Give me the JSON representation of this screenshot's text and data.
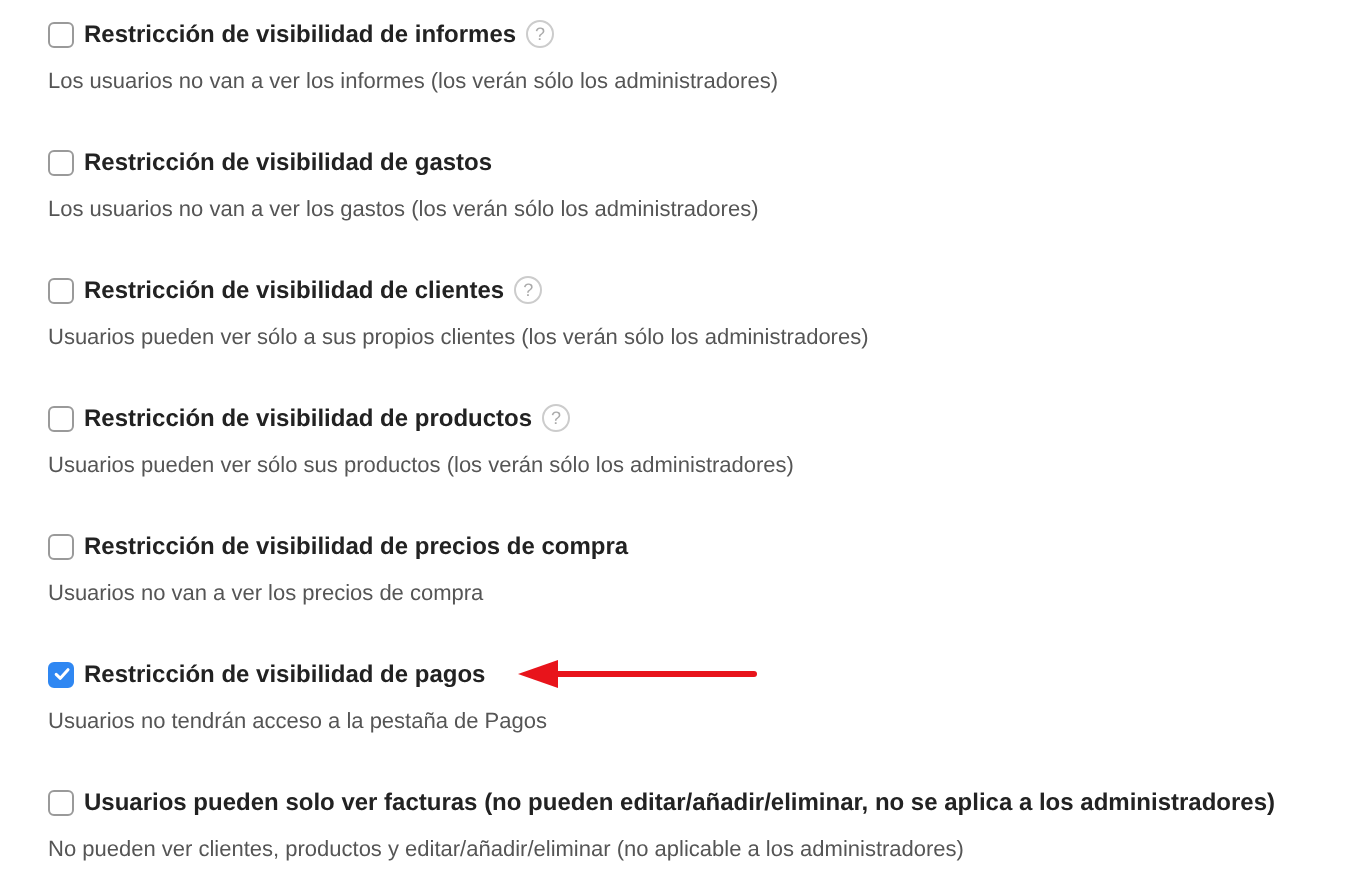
{
  "options": [
    {
      "label": "Restricción de visibilidad de informes",
      "checked": false,
      "help": "?",
      "description": "Los usuarios no van a ver los informes (los verán sólo los administradores)"
    },
    {
      "label": "Restricción de visibilidad de gastos",
      "checked": false,
      "description": "Los usuarios no van a ver los gastos (los verán sólo los administradores)"
    },
    {
      "label": "Restricción de visibilidad de clientes",
      "checked": false,
      "help": "?",
      "description": "Usuarios pueden ver sólo a sus propios clientes (los verán sólo los administradores)"
    },
    {
      "label": "Restricción de visibilidad de productos",
      "checked": false,
      "help": "?",
      "description": "Usuarios pueden ver sólo sus productos (los verán sólo los administradores)"
    },
    {
      "label": "Restricción de visibilidad de precios de compra",
      "checked": false,
      "description": "Usuarios no van a ver los precios de compra"
    },
    {
      "label": "Restricción de visibilidad de pagos",
      "checked": true,
      "arrow": true,
      "description": "Usuarios no tendrán acceso a la pestaña de Pagos"
    },
    {
      "label": "Usuarios pueden solo ver facturas (no pueden editar/añadir/eliminar, no se aplica a los administradores)",
      "checked": false,
      "description": "No pueden ver clientes, productos y editar/añadir/eliminar (no aplicable a los administradores)"
    }
  ]
}
